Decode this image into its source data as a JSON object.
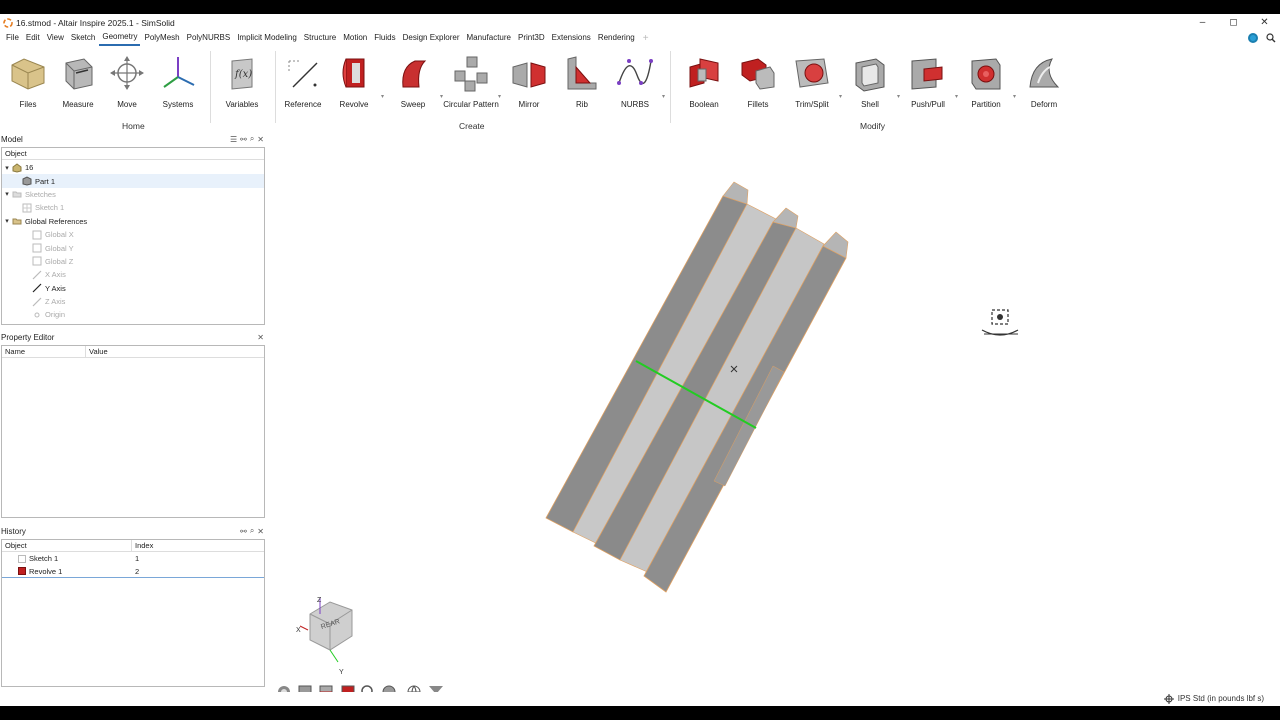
{
  "window": {
    "title": "16.stmod - Altair Inspire 2025.1 - SimSolid",
    "controls": [
      "–",
      "◻",
      "✕"
    ]
  },
  "menu": {
    "items": [
      "File",
      "Edit",
      "View",
      "Sketch",
      "Geometry",
      "PolyMesh",
      "PolyNURBS",
      "Implicit Modeling",
      "Structure",
      "Motion",
      "Fluids",
      "Design Explorer",
      "Manufacture",
      "Print3D",
      "Extensions",
      "Rendering"
    ],
    "active": "Geometry",
    "add_tab": "+"
  },
  "ribbon": {
    "home": {
      "label": "Home",
      "tools": [
        "Files",
        "Measure",
        "Move",
        "Systems"
      ]
    },
    "variables": {
      "tools": [
        "Variables"
      ]
    },
    "create": {
      "label": "Create",
      "tools": [
        "Reference",
        "Revolve",
        "Sweep",
        "Circular Pattern",
        "Mirror",
        "Rib",
        "NURBS"
      ]
    },
    "modify": {
      "label": "Modify",
      "tools": [
        "Boolean",
        "Fillets",
        "Trim/Split",
        "Shell",
        "Push/Pull",
        "Partition",
        "Deform"
      ]
    }
  },
  "model_panel": {
    "title": "Model",
    "column": "Object",
    "rows": [
      {
        "label": "16",
        "expand": "▾"
      },
      {
        "label": "Part 1",
        "expand": ""
      },
      {
        "label": "Sketches",
        "expand": "▾"
      },
      {
        "label": "Sketch 1",
        "expand": ""
      },
      {
        "label": "Global References",
        "expand": "▾"
      },
      {
        "label": "Global X",
        "expand": ""
      },
      {
        "label": "Global Y",
        "expand": ""
      },
      {
        "label": "Global Z",
        "expand": ""
      },
      {
        "label": "X Axis",
        "expand": ""
      },
      {
        "label": "Y Axis",
        "expand": ""
      },
      {
        "label": "Z Axis",
        "expand": ""
      },
      {
        "label": "Origin",
        "expand": ""
      }
    ]
  },
  "property_panel": {
    "title": "Property Editor",
    "columns": [
      "Name",
      "Value"
    ]
  },
  "history_panel": {
    "title": "History",
    "columns": [
      "Object",
      "Index"
    ],
    "rows": [
      {
        "object": "Sketch 1",
        "index": "1"
      },
      {
        "object": "Revolve 1",
        "index": "2"
      }
    ]
  },
  "view_cube": {
    "face": "REAR",
    "axes": {
      "x": "X",
      "y": "Y",
      "z": "Z"
    }
  },
  "status": {
    "units": "IPS Std (in pounds lbf s)"
  },
  "colors": {
    "accent": "#2b6cb0",
    "part_gray": "#9a9a9a",
    "edge_orange": "#e0a060",
    "axis_green": "#22cc22"
  }
}
